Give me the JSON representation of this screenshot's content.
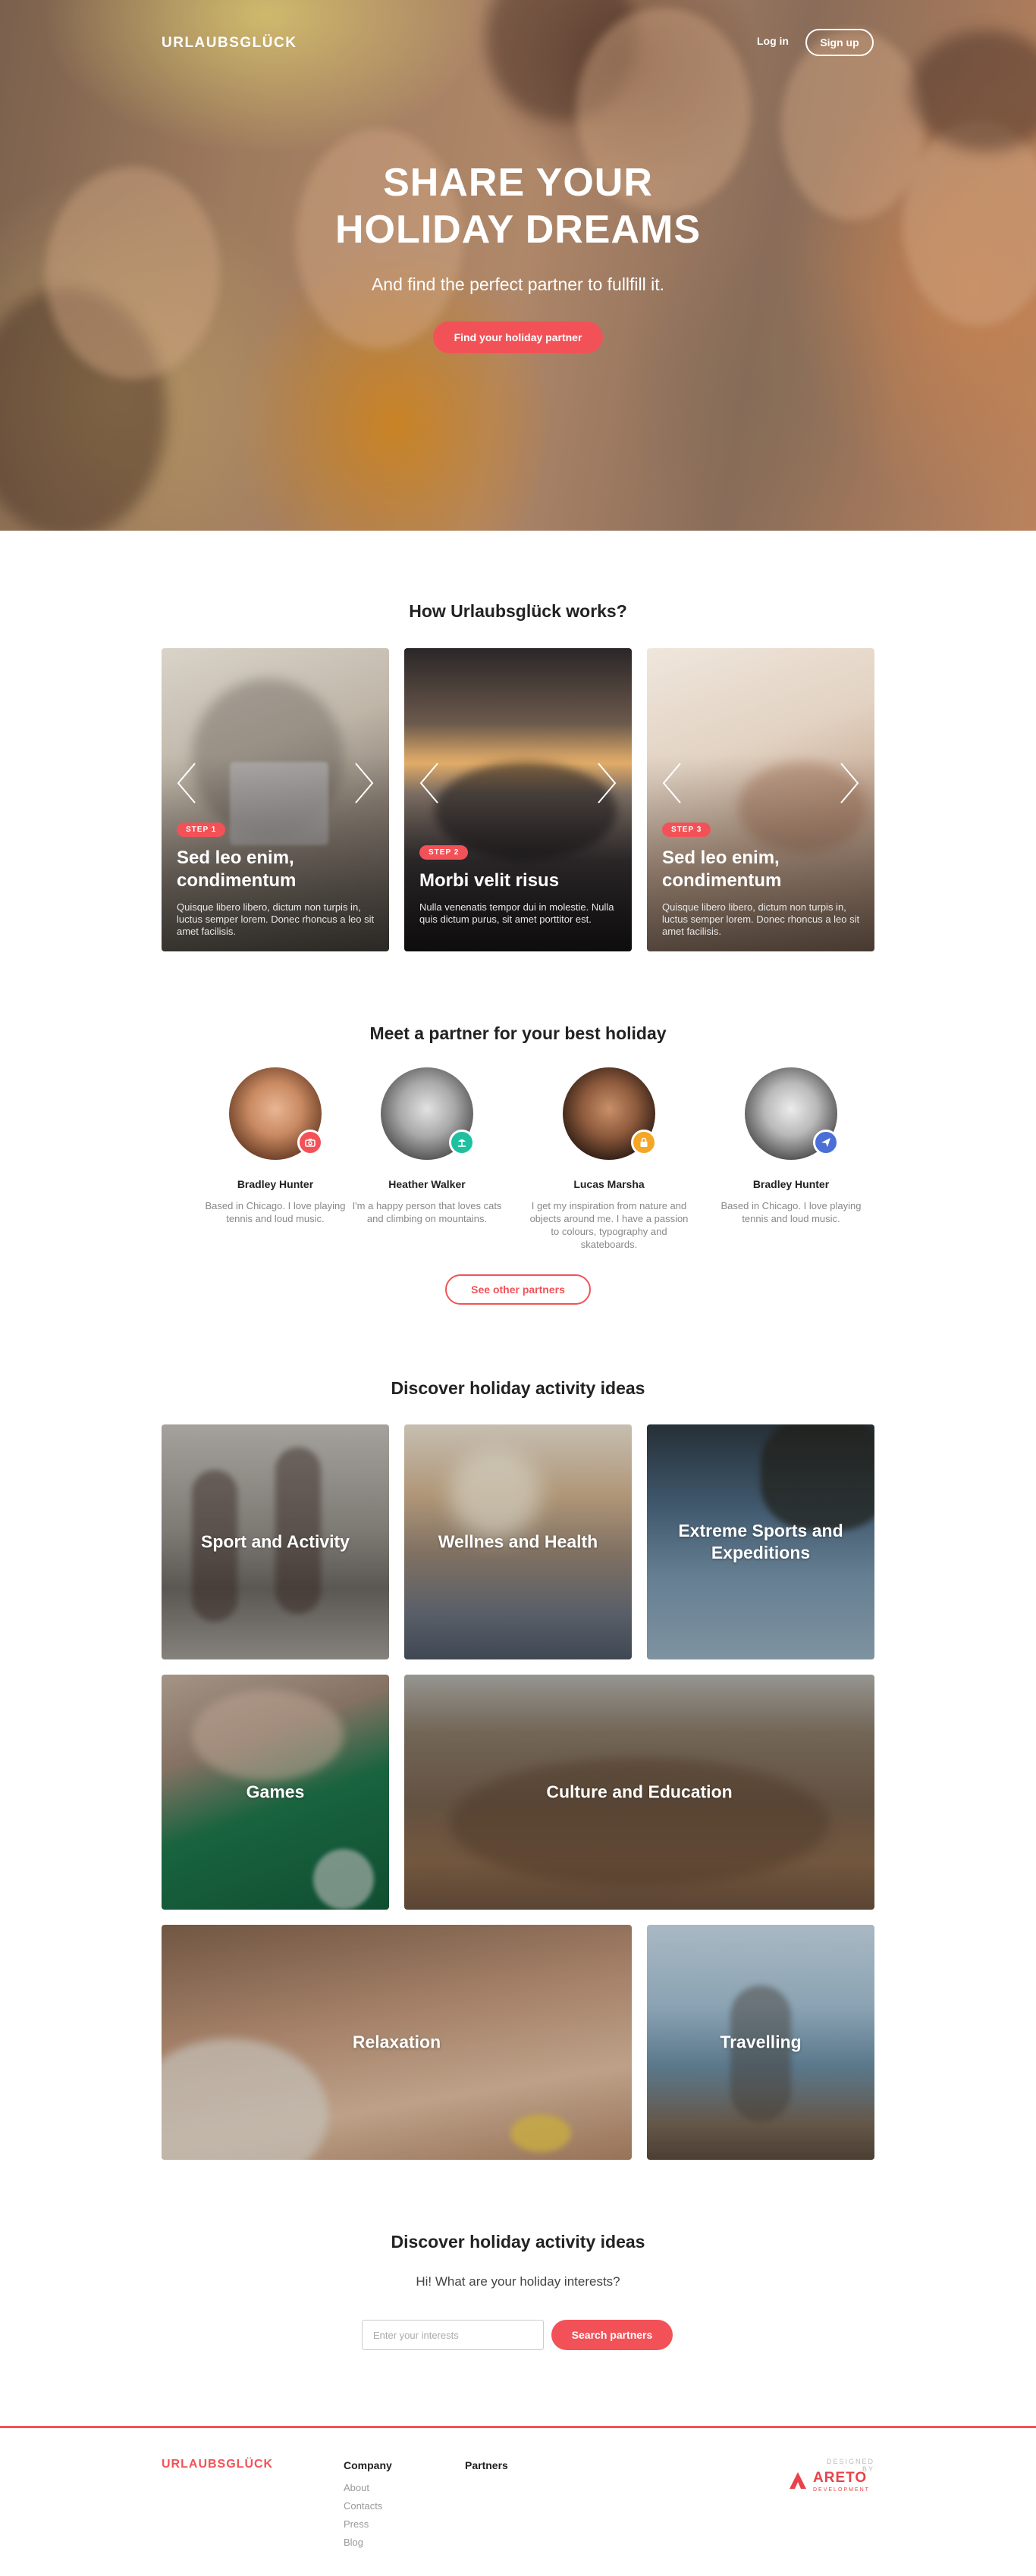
{
  "header": {
    "logo": "URLAUBSGLÜCK",
    "login": "Log in",
    "signup": "Sign up"
  },
  "hero": {
    "title_line1": "SHARE YOUR",
    "title_line2": "HOLIDAY DREAMS",
    "subtitle": "And find the perfect partner to fullfill it.",
    "cta": "Find your holiday partner"
  },
  "how": {
    "title": "How Urlaubsglück works?",
    "steps": [
      {
        "badge": "STEP 1",
        "title": "Sed leo enim, condimentum",
        "text": "Quisque libero libero, dictum non turpis in, luctus semper lorem. Donec rhoncus a leo sit amet facilisis."
      },
      {
        "badge": "STEP 2",
        "title": "Morbi velit risus",
        "text": "Nulla venenatis tempor dui in molestie. Nulla quis dictum purus, sit amet porttitor est."
      },
      {
        "badge": "STEP 3",
        "title": "Sed leo enim, condimentum",
        "text": "Quisque libero libero, dictum non turpis in, luctus semper lorem. Donec rhoncus a leo sit amet facilisis."
      }
    ]
  },
  "partners": {
    "title": "Meet a partner for your best holiday",
    "items": [
      {
        "name": "Bradley Hunter",
        "desc": "Based in Chicago. I love playing tennis and loud music.",
        "badge_color": "#f25257",
        "badge_icon": "camera-icon"
      },
      {
        "name": "Heather Walker",
        "desc": "I'm a happy person that loves cats and climbing on mountains.",
        "badge_color": "#1fc0a0",
        "badge_icon": "beach-icon"
      },
      {
        "name": "Lucas Marsha",
        "desc": "I get my inspiration from nature and objects around me. I have a passion to colours, typography and skateboards.",
        "badge_color": "#f5a623",
        "badge_icon": "lock-icon"
      },
      {
        "name": "Bradley Hunter",
        "desc": "Based in Chicago. I love playing tennis and loud music.",
        "badge_color": "#4a6fd6",
        "badge_icon": "plane-icon"
      }
    ],
    "more": "See other partners"
  },
  "activities": {
    "title": "Discover holiday activity ideas",
    "tiles": [
      {
        "label": "Sport and Activity"
      },
      {
        "label": "Wellnes and Health"
      },
      {
        "label": "Extreme Sports and Expeditions"
      },
      {
        "label": "Games"
      },
      {
        "label": "Culture and Education"
      },
      {
        "label": "Relaxation"
      },
      {
        "label": "Travelling"
      }
    ]
  },
  "search": {
    "title": "Discover holiday activity ideas",
    "subtitle": "Hi! What are your holiday interests?",
    "placeholder": "Enter your interests",
    "button": "Search partners"
  },
  "footer": {
    "logo": "URLAUBSGLÜCK",
    "company_heading": "Company",
    "company_links": [
      "About",
      "Contacts",
      "Press",
      "Blog"
    ],
    "partners_heading": "Partners",
    "designed_by": "DESIGNED BY",
    "brand": "ARETO",
    "brand_tag": "DEVELOPMENT"
  },
  "colors": {
    "accent": "#f25257",
    "text": "#222222",
    "muted": "#888888"
  }
}
